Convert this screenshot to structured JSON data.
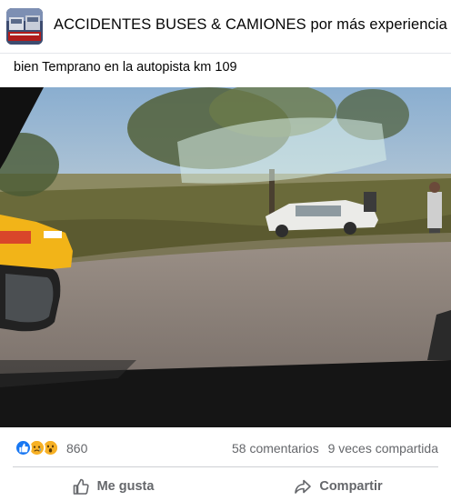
{
  "post": {
    "group_name": "ACCIDENTES BUSES & CAMIONES por más experiencia y",
    "text": "bien Temprano en la autopista km 109"
  },
  "reactions": {
    "icons": [
      "like-icon",
      "sad-icon",
      "wow-icon"
    ],
    "count": "860",
    "comments": "58 comentarios",
    "shares": "9 veces compartida"
  },
  "actions": {
    "like_label": "Me gusta",
    "share_label": "Compartir"
  },
  "colors": {
    "like_blue": "#1877f2",
    "emoji_yellow": "#f7b125",
    "secondary_text": "#65676b",
    "divider": "#ced0d4"
  }
}
